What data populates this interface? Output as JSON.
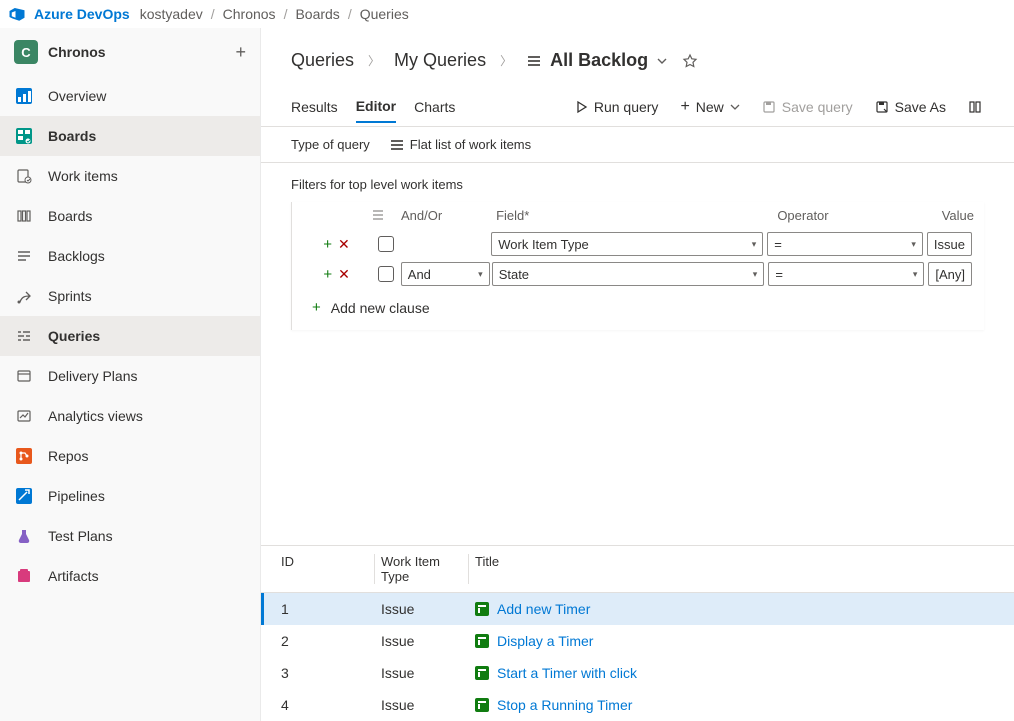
{
  "brand": "Azure DevOps",
  "breadcrumb": [
    "kostyadev",
    "Chronos",
    "Boards",
    "Queries"
  ],
  "project": {
    "initial": "C",
    "name": "Chronos"
  },
  "sidebar": {
    "items": [
      {
        "label": "Overview"
      },
      {
        "label": "Boards"
      },
      {
        "label": "Work items"
      },
      {
        "label": "Boards"
      },
      {
        "label": "Backlogs"
      },
      {
        "label": "Sprints"
      },
      {
        "label": "Queries"
      },
      {
        "label": "Delivery Plans"
      },
      {
        "label": "Analytics views"
      },
      {
        "label": "Repos"
      },
      {
        "label": "Pipelines"
      },
      {
        "label": "Test Plans"
      },
      {
        "label": "Artifacts"
      }
    ]
  },
  "header": {
    "path1": "Queries",
    "path2": "My Queries",
    "query_name": "All Backlog"
  },
  "tabs": {
    "results": "Results",
    "editor": "Editor",
    "charts": "Charts"
  },
  "actions": {
    "run": "Run query",
    "new": "New",
    "save": "Save query",
    "saveas": "Save As"
  },
  "typerow": {
    "label": "Type of query",
    "value": "Flat list of work items"
  },
  "filters": {
    "label": "Filters for top level work items",
    "headers": {
      "andor": "And/Or",
      "field": "Field*",
      "operator": "Operator",
      "value": "Value"
    },
    "rows": [
      {
        "andor": "",
        "field": "Work Item Type",
        "op": "=",
        "val": "Issue"
      },
      {
        "andor": "And",
        "field": "State",
        "op": "=",
        "val": "[Any]"
      }
    ],
    "add_clause": "Add new clause"
  },
  "results": {
    "headers": {
      "id": "ID",
      "type": "Work Item Type",
      "title": "Title"
    },
    "rows": [
      {
        "id": "1",
        "type": "Issue",
        "title": "Add new Timer"
      },
      {
        "id": "2",
        "type": "Issue",
        "title": "Display a Timer"
      },
      {
        "id": "3",
        "type": "Issue",
        "title": "Start a Timer with click"
      },
      {
        "id": "4",
        "type": "Issue",
        "title": "Stop a Running Timer"
      }
    ]
  }
}
